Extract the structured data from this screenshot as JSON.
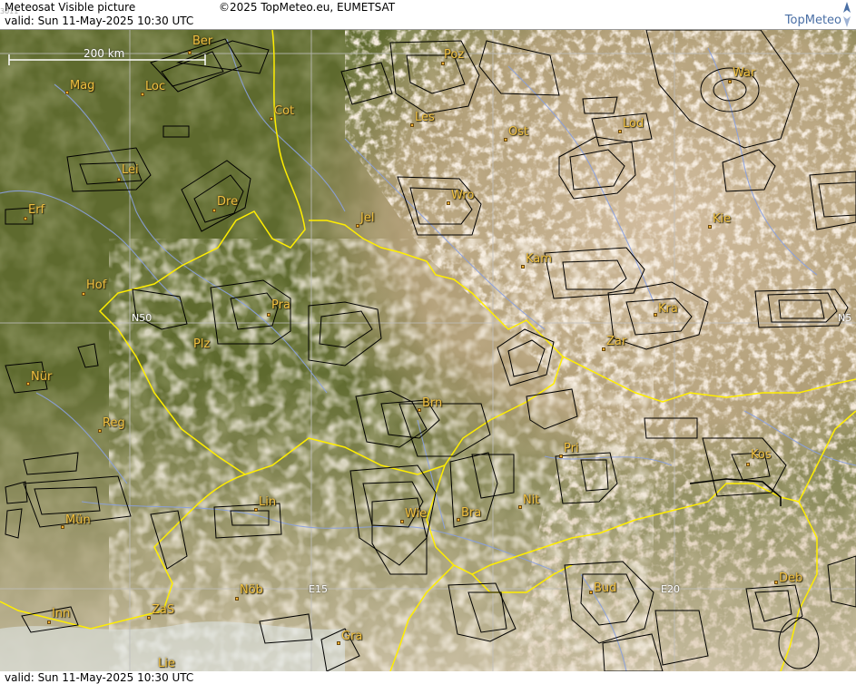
{
  "header": {
    "title": "Meteosat Visible picture",
    "valid": "valid:  Sun  11-May-2025  10:30 UTC",
    "copyright": "©2025 TopMeteo.eu, EUMETSAT",
    "code": "3011",
    "brand": "TopMeteo"
  },
  "footer": {
    "valid": "valid:  Sun  11-May-2025  10:30 UTC"
  },
  "scale": {
    "label": "200 km"
  },
  "grid_labels": {
    "n50_left": "N50",
    "n50_right": "N5",
    "e15": "E15",
    "e20": "E20"
  },
  "cities": [
    {
      "id": "ber",
      "label": "Ber"
    },
    {
      "id": "poz",
      "label": "Poz"
    },
    {
      "id": "war",
      "label": "War"
    },
    {
      "id": "mag",
      "label": "Mag"
    },
    {
      "id": "loc",
      "label": "Loc"
    },
    {
      "id": "cot",
      "label": "Cot"
    },
    {
      "id": "les",
      "label": "Les"
    },
    {
      "id": "ost",
      "label": "Ost"
    },
    {
      "id": "lod",
      "label": "Lod"
    },
    {
      "id": "lei",
      "label": "Lei"
    },
    {
      "id": "dre",
      "label": "Dre"
    },
    {
      "id": "wro",
      "label": "Wro"
    },
    {
      "id": "erf",
      "label": "Erf"
    },
    {
      "id": "jel",
      "label": "Jel"
    },
    {
      "id": "kie",
      "label": "Kie"
    },
    {
      "id": "kam",
      "label": "Kam"
    },
    {
      "id": "hof",
      "label": "Hof"
    },
    {
      "id": "pra",
      "label": "Pra"
    },
    {
      "id": "kra",
      "label": "Kra"
    },
    {
      "id": "plz",
      "label": "Plz"
    },
    {
      "id": "zar",
      "label": "Zar"
    },
    {
      "id": "nur",
      "label": "Nür"
    },
    {
      "id": "brn",
      "label": "Brn"
    },
    {
      "id": "reg",
      "label": "Reg"
    },
    {
      "id": "pri",
      "label": "Pri"
    },
    {
      "id": "kos",
      "label": "Kos"
    },
    {
      "id": "lin",
      "label": "Lin"
    },
    {
      "id": "nit",
      "label": "Nit"
    },
    {
      "id": "mun",
      "label": "Mün"
    },
    {
      "id": "wie",
      "label": "Wie"
    },
    {
      "id": "bra",
      "label": "Bra"
    },
    {
      "id": "bud",
      "label": "Bud"
    },
    {
      "id": "deb",
      "label": "Deb"
    },
    {
      "id": "nob",
      "label": "Nöb"
    },
    {
      "id": "zas",
      "label": "ZaS"
    },
    {
      "id": "inn",
      "label": "Inn"
    },
    {
      "id": "gra",
      "label": "Gra"
    },
    {
      "id": "lie",
      "label": "Lie"
    }
  ],
  "colors": {
    "land": "#5e6a2e",
    "cloud": "#e6d3bc",
    "border": "#ffee00",
    "river": "#8aa0e0",
    "airspace": "#000000",
    "grid": "#bfbfbf",
    "city_label": "#f0c040"
  }
}
